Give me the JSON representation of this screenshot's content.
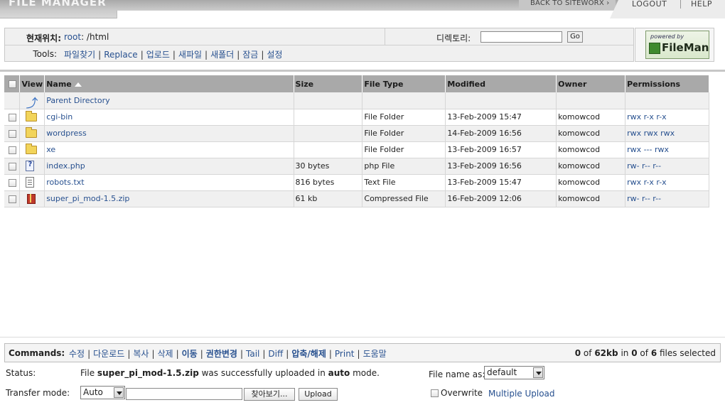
{
  "header": {
    "app_title": "FILE MANAGER",
    "back_label": "BACK TO SITEWORX",
    "logout_label": "LOGOUT",
    "help_label": "HELP"
  },
  "location": {
    "label": "현재위치:",
    "path_root": "root",
    "path_sep": ": /html",
    "directory_label": "디렉토리:",
    "directory_value": "",
    "go_label": "Go"
  },
  "tools": {
    "label": "Tools:",
    "items": [
      "파일찾기",
      "Replace",
      "업로드",
      "새파일",
      "새폴더",
      "잠금",
      "설정"
    ]
  },
  "logo": {
    "powered_by": "powered by",
    "brand": "FileMan"
  },
  "table": {
    "columns": [
      "View",
      "Name",
      "Size",
      "File Type",
      "Modified",
      "Owner",
      "Permissions"
    ],
    "parent_label": "Parent Directory",
    "rows": [
      {
        "icon": "folder-icon",
        "name": "cgi-bin",
        "size": "",
        "type": "File Folder",
        "modified": "13-Feb-2009 15:47",
        "owner": "komowcod",
        "perms": "rwx r-x r-x"
      },
      {
        "icon": "folder-icon",
        "name": "wordpress",
        "size": "",
        "type": "File Folder",
        "modified": "14-Feb-2009 16:56",
        "owner": "komowcod",
        "perms": "rwx rwx rwx"
      },
      {
        "icon": "folder-icon",
        "name": "xe",
        "size": "",
        "type": "File Folder",
        "modified": "13-Feb-2009 16:57",
        "owner": "komowcod",
        "perms": "rwx --- rwx"
      },
      {
        "icon": "php-file-icon",
        "name": "index.php",
        "size": "30 bytes",
        "type": "php File",
        "modified": "13-Feb-2009 16:56",
        "owner": "komowcod",
        "perms": "rw- r-- r--"
      },
      {
        "icon": "text-file-icon",
        "name": "robots.txt",
        "size": "816 bytes",
        "type": "Text File",
        "modified": "13-Feb-2009 15:47",
        "owner": "komowcod",
        "perms": "rwx r-x r-x"
      },
      {
        "icon": "zip-file-icon",
        "name": "super_pi_mod-1.5.zip",
        "size": "61 kb",
        "type": "Compressed File",
        "modified": "16-Feb-2009 12:06",
        "owner": "komowcod",
        "perms": "rw- r-- r--"
      }
    ]
  },
  "commands": {
    "label": "Commands:",
    "items": [
      {
        "text": "수정",
        "bold": false
      },
      {
        "text": "다운로드",
        "bold": false
      },
      {
        "text": "복사",
        "bold": false
      },
      {
        "text": "삭제",
        "bold": false
      },
      {
        "text": "이동",
        "bold": true
      },
      {
        "text": "권한변경",
        "bold": true
      },
      {
        "text": "Tail",
        "bold": false
      },
      {
        "text": "Diff",
        "bold": false
      },
      {
        "text": "압축/해제",
        "bold": true
      },
      {
        "text": "Print",
        "bold": false
      },
      {
        "text": "도움말",
        "bold": false
      }
    ],
    "selection": {
      "selected_size": "0",
      "of1": "of",
      "total_size": "62kb",
      "in": "in",
      "selected_count": "0",
      "of2": "of",
      "total_count": "6",
      "suffix": "files selected"
    }
  },
  "status": {
    "label": "Status:",
    "prefix": "File",
    "file": "super_pi_mod-1.5.zip",
    "middle": "was successfully uploaded in",
    "mode": "auto",
    "suffix": "mode."
  },
  "filename_as": {
    "label": "File name as:",
    "value": "default"
  },
  "transfer": {
    "label": "Transfer mode:",
    "mode_value": "Auto",
    "browse_label": "찾아보기...",
    "upload_label": "Upload",
    "overwrite_label": "Overwrite",
    "multiple_upload_label": "Multiple Upload"
  }
}
